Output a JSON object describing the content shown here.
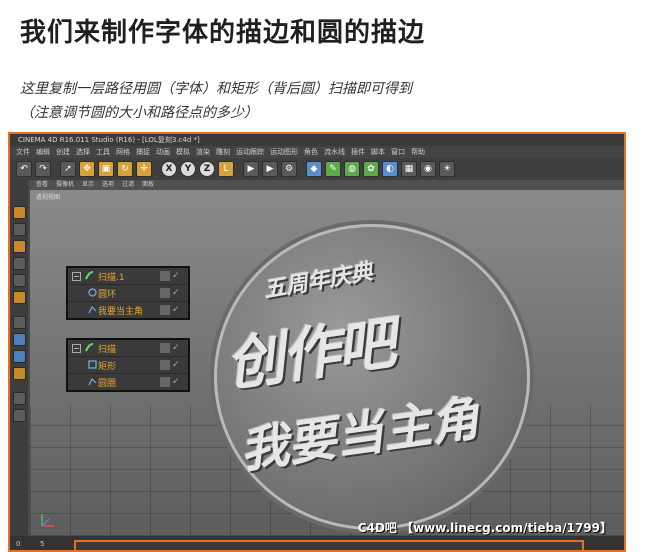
{
  "heading": {
    "title": "我们来制作字体的描边和圆的描边",
    "line1": "这里复制一层路径用圆（字体）和矩形（背后圆）扫描即可得到",
    "line2": "（注意调节圆的大小和路径点的多少）"
  },
  "app": {
    "window_title": "CINEMA 4D R16.011 Studio (R16) - [LOL复刻3.c4d *]",
    "menu": [
      "文件",
      "编辑",
      "创建",
      "选择",
      "工具",
      "网格",
      "捕捉",
      "动画",
      "模拟",
      "渲染",
      "雕刻",
      "运动跟踪",
      "运动图形",
      "角色",
      "流水线",
      "插件",
      "脚本",
      "窗口",
      "帮助"
    ],
    "view_menu": [
      "查看",
      "摄像机",
      "显示",
      "选项",
      "过滤",
      "面板"
    ],
    "viewport_label": "透视视图",
    "status_left": "0",
    "status_mid": "5"
  },
  "coin_text": {
    "line1": "五周年庆典",
    "line2": "创作吧",
    "line3": "我要当主角"
  },
  "panel1": {
    "rows": [
      {
        "name": "扫描.1",
        "icon": "sweep-icon"
      },
      {
        "name": "圆环",
        "icon": "circle-icon"
      },
      {
        "name": "我要当主角",
        "icon": "spline-icon"
      }
    ]
  },
  "panel2": {
    "rows": [
      {
        "name": "扫描",
        "icon": "sweep-icon"
      },
      {
        "name": "矩形",
        "icon": "rectangle-icon"
      },
      {
        "name": "圆圈",
        "icon": "spline-icon"
      }
    ]
  },
  "watermark": "C4D吧 【www.linecg.com/tieba/1799】",
  "colors": {
    "accent": "#e8711f",
    "object_name": "#e8a637",
    "check": "#6cd66c"
  }
}
